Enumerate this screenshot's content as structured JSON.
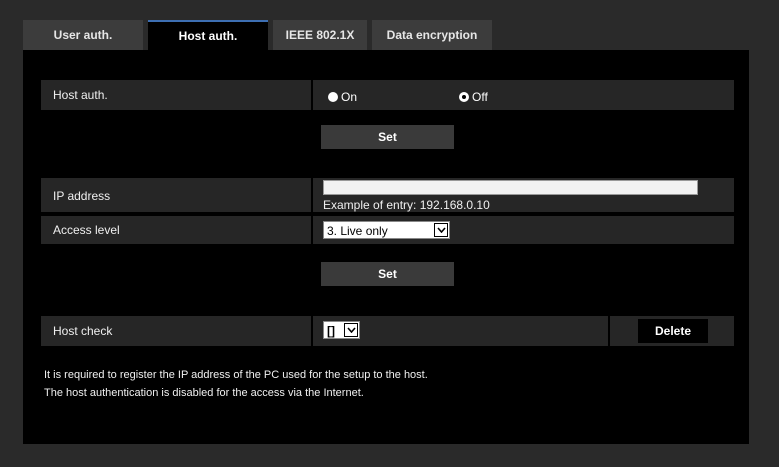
{
  "tabs": [
    {
      "label": "User auth.",
      "active": false
    },
    {
      "label": "Host auth.",
      "active": true
    },
    {
      "label": "IEEE 802.1X",
      "active": false
    },
    {
      "label": "Data encryption",
      "active": false
    }
  ],
  "host_auth": {
    "label": "Host auth.",
    "options": [
      {
        "label": "On",
        "selected": false
      },
      {
        "label": "Off",
        "selected": true
      }
    ],
    "set_label": "Set"
  },
  "ip_address": {
    "label": "IP address",
    "value": "",
    "example": "Example of entry: 192.168.0.10"
  },
  "access_level": {
    "label": "Access level",
    "selected": "3. Live only"
  },
  "set2_label": "Set",
  "host_check": {
    "label": "Host check",
    "selected": "[]",
    "delete_label": "Delete"
  },
  "notes": [
    "It is required to register the IP address of the PC used for the setup to the host.",
    "The host authentication is disabled for the access via the Internet."
  ],
  "colors": {
    "page_bg": "#2a2a2a",
    "panel_bg": "#000000",
    "row_bg": "#262626",
    "tab_bg": "#3c3c3c",
    "tab_active_accent": "#3d6fb3",
    "button_bg": "#3a3a3a"
  }
}
